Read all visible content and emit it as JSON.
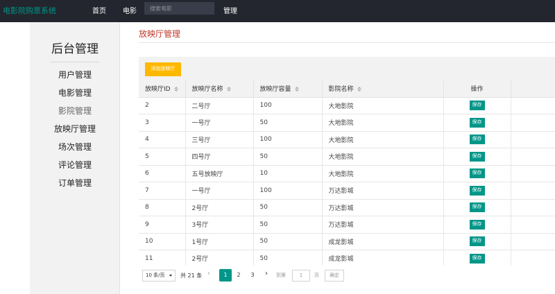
{
  "nav": {
    "brand": "电影院购票系统",
    "home": "首页",
    "movie": "电影",
    "search_placeholder": "搜索电影",
    "admin": "管理"
  },
  "sidebar": {
    "title": "后台管理",
    "items": [
      {
        "label": "用户管理"
      },
      {
        "label": "电影管理"
      },
      {
        "label": "影院管理"
      },
      {
        "label": "放映厅管理"
      },
      {
        "label": "场次管理"
      },
      {
        "label": "评论管理"
      },
      {
        "label": "订单管理"
      }
    ]
  },
  "main": {
    "heading": "放映厅管理",
    "add_button": "添加放映厅",
    "columns": [
      "放映厅ID",
      "放映厅名称",
      "放映厅容量",
      "影院名称",
      "操作"
    ],
    "save_label": "保存",
    "rows": [
      {
        "id": "2",
        "name": "二号厅",
        "capacity": "100",
        "cinema": "大地影院"
      },
      {
        "id": "3",
        "name": "一号厅",
        "capacity": "50",
        "cinema": "大地影院"
      },
      {
        "id": "4",
        "name": "三号厅",
        "capacity": "100",
        "cinema": "大地影院"
      },
      {
        "id": "5",
        "name": "四号厅",
        "capacity": "50",
        "cinema": "大地影院"
      },
      {
        "id": "6",
        "name": "五号放映厅",
        "capacity": "10",
        "cinema": "大地影院"
      },
      {
        "id": "7",
        "name": "一号厅",
        "capacity": "100",
        "cinema": "万达影城"
      },
      {
        "id": "8",
        "name": "2号厅",
        "capacity": "50",
        "cinema": "万达影城"
      },
      {
        "id": "9",
        "name": "3号厅",
        "capacity": "50",
        "cinema": "万达影城"
      },
      {
        "id": "10",
        "name": "1号厅",
        "capacity": "50",
        "cinema": "成龙影城"
      },
      {
        "id": "11",
        "name": "2号厅",
        "capacity": "50",
        "cinema": "成龙影城"
      }
    ]
  },
  "pager": {
    "page_size": "10 条/页",
    "total": "共 21 条",
    "pages": [
      "1",
      "2",
      "3"
    ],
    "current_page": "1",
    "goto_label": "到第",
    "goto_value": "1",
    "page_unit": "页",
    "confirm": "确定"
  },
  "colors": {
    "topbar": "#23262e",
    "brand": "#009688",
    "add_button": "#ffb800",
    "save_button": "#009688",
    "heading": "#c0392b"
  }
}
